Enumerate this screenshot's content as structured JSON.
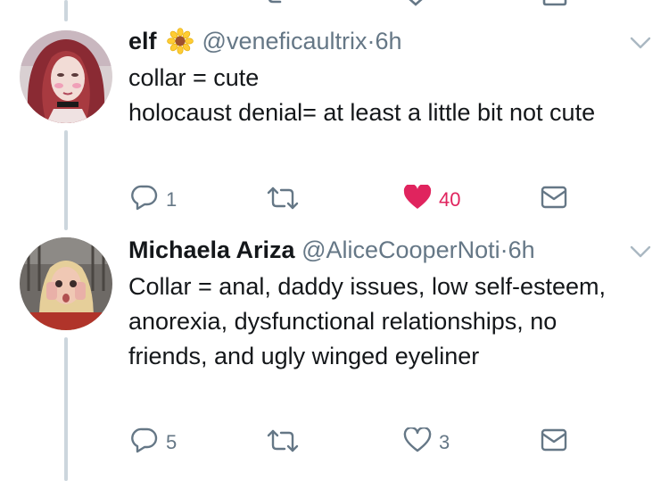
{
  "tweets": [
    {
      "name": "elf",
      "has_emoji": true,
      "emoji_name": "sunflower-emoji",
      "handle": "@veneficaultrix",
      "dot": "·",
      "time": "6h",
      "text": "collar = cute\nholocaust denial= at least a little bit not cute",
      "reply_count": "1",
      "retweet_count": "",
      "like_count": "40",
      "liked": true,
      "accent_like": "#e0245e"
    },
    {
      "name": "Michaela Ariza",
      "has_emoji": false,
      "handle": "@AliceCooperNoti",
      "dot": "·",
      "time": "6h",
      "text": "Collar = anal, daddy issues, low self-esteem, anorexia, dysfunctional relationships, no friends, and ugly winged eyeliner",
      "reply_count": "5",
      "retweet_count": "",
      "like_count": "3",
      "liked": false
    }
  ],
  "colors": {
    "text": "#14171a",
    "secondary": "#657786",
    "thread_line": "#ccd6dd",
    "like_active": "#e0245e"
  }
}
